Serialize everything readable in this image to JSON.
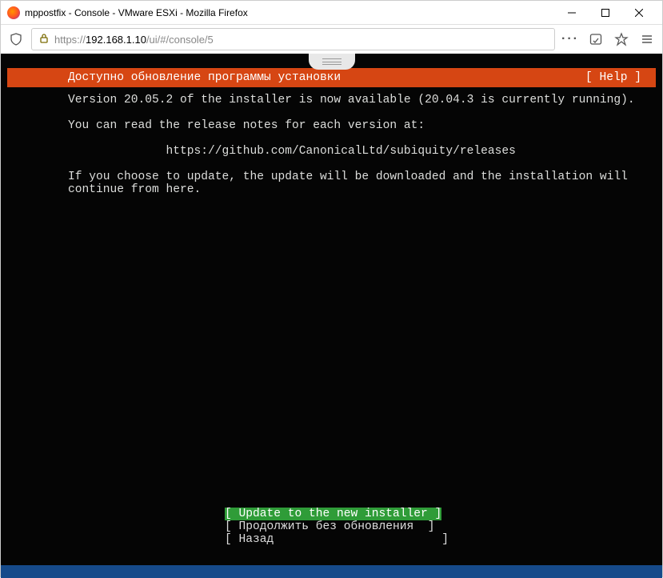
{
  "window": {
    "title": "mppostfix - Console - VMware ESXi - Mozilla Firefox"
  },
  "addressbar": {
    "url_prefix": "https://",
    "url_host": "192.168.1.10",
    "url_path": "/ui/#/console/5"
  },
  "installer": {
    "header_title": "Доступно обновление программы установки",
    "help": "[ Help ]",
    "line1": "Version 20.05.2 of the installer is now available (20.04.3 is currently running).",
    "line2": "You can read the release notes for each version at:",
    "url": "https://github.com/CanonicalLtd/subiquity/releases",
    "line3": "If you choose to update, the update will be downloaded and the installation will continue from here.",
    "buttons": {
      "update": "[ Update to the new installer ]",
      "continue": "[ Продолжить без обновления  ]",
      "back": "[ Назад                        ]"
    }
  }
}
